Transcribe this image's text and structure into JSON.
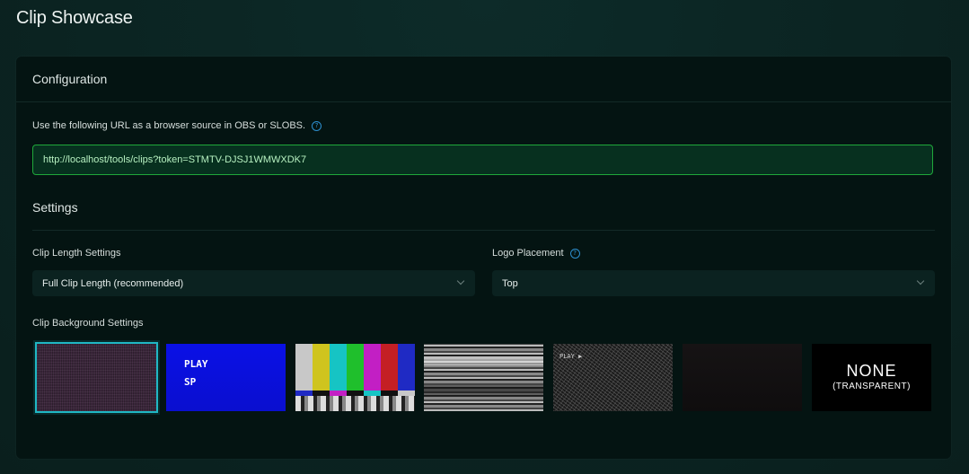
{
  "page": {
    "title": "Clip Showcase"
  },
  "configuration": {
    "title": "Configuration",
    "url_description": "Use the following URL as a browser source in OBS or SLOBS.",
    "url_help_icon": "question-circle-icon",
    "url_value": "http://localhost/tools/clips?token=STMTV-DJSJ1WMWXDK7"
  },
  "settings": {
    "title": "Settings",
    "clip_length": {
      "label": "Clip Length Settings",
      "value": "Full Clip Length (recommended)"
    },
    "logo_placement": {
      "label": "Logo Placement",
      "value": "Top",
      "help_icon": "question-circle-icon"
    },
    "background": {
      "label": "Clip Background Settings",
      "selected_index": 0,
      "options": [
        {
          "id": "noise-purple"
        },
        {
          "id": "vhs-blue",
          "lines": [
            "PLAY",
            "SP"
          ]
        },
        {
          "id": "color-bars"
        },
        {
          "id": "gray-static"
        },
        {
          "id": "tv-static",
          "text": "PLAY ▶"
        },
        {
          "id": "dark-film"
        },
        {
          "id": "none",
          "title": "NONE",
          "subtitle": "(TRANSPARENT)"
        }
      ]
    }
  },
  "colors": {
    "accent_green": "#1fa83a",
    "selected_outline": "#1fb8c4",
    "help_blue": "#2d8fd0",
    "card_bg": "#041412",
    "page_bg": "#0b2422"
  }
}
